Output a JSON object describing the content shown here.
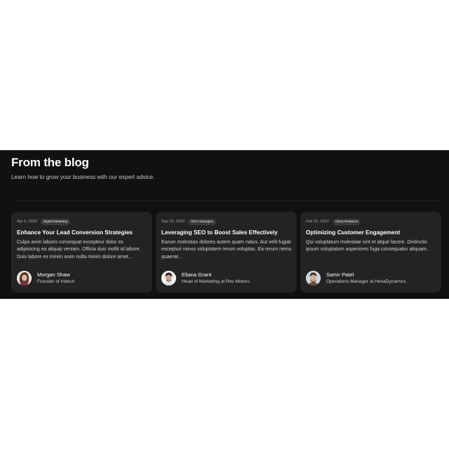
{
  "blog": {
    "title": "From the blog",
    "subtitle": "Learn how to grow your business with our expert advice.",
    "posts": [
      {
        "date": "Apr 5, 2023",
        "tag": "Digital Marketing",
        "title": "Enhance Your Lead Conversion Strategies",
        "excerpt": "Culpa anim laboris consequat excepteur dolor ex adipisicing ea aliquip veniam. Officia duis mollit id labore. Duis labore ex minim anim nulla minim dolore amet...",
        "author": {
          "name": "Morgan Shaw",
          "role": "Founder of Initech"
        }
      },
      {
        "date": "Sep 15, 2023",
        "tag": "SEO Strategies",
        "title": "Leveraging SEO to Boost Sales Effectively",
        "excerpt": "Earum molestias dolores autem quam natus. Aut velit fugiat excepturi minus voluptatem rerum voluptas. Ea rerum nemo quaerat...",
        "author": {
          "name": "Eliana Grant",
          "role": "Head of Marketing at Rev Motors"
        }
      },
      {
        "date": "Feb 20, 2022",
        "tag": "Client Relations",
        "title": "Optimizing Customer Engagement",
        "excerpt": "Qui voluptatum molestiae sint et atque facere. Distinctio ipsum voluptatum asperiores fuga consequatur aliquam.",
        "author": {
          "name": "Samir Patel",
          "role": "Operations Manager at HexaDynamics"
        }
      }
    ]
  },
  "colors": {
    "section_bg": "#111111",
    "card_bg": "#232323",
    "tag_bg": "#3a3a3a"
  }
}
